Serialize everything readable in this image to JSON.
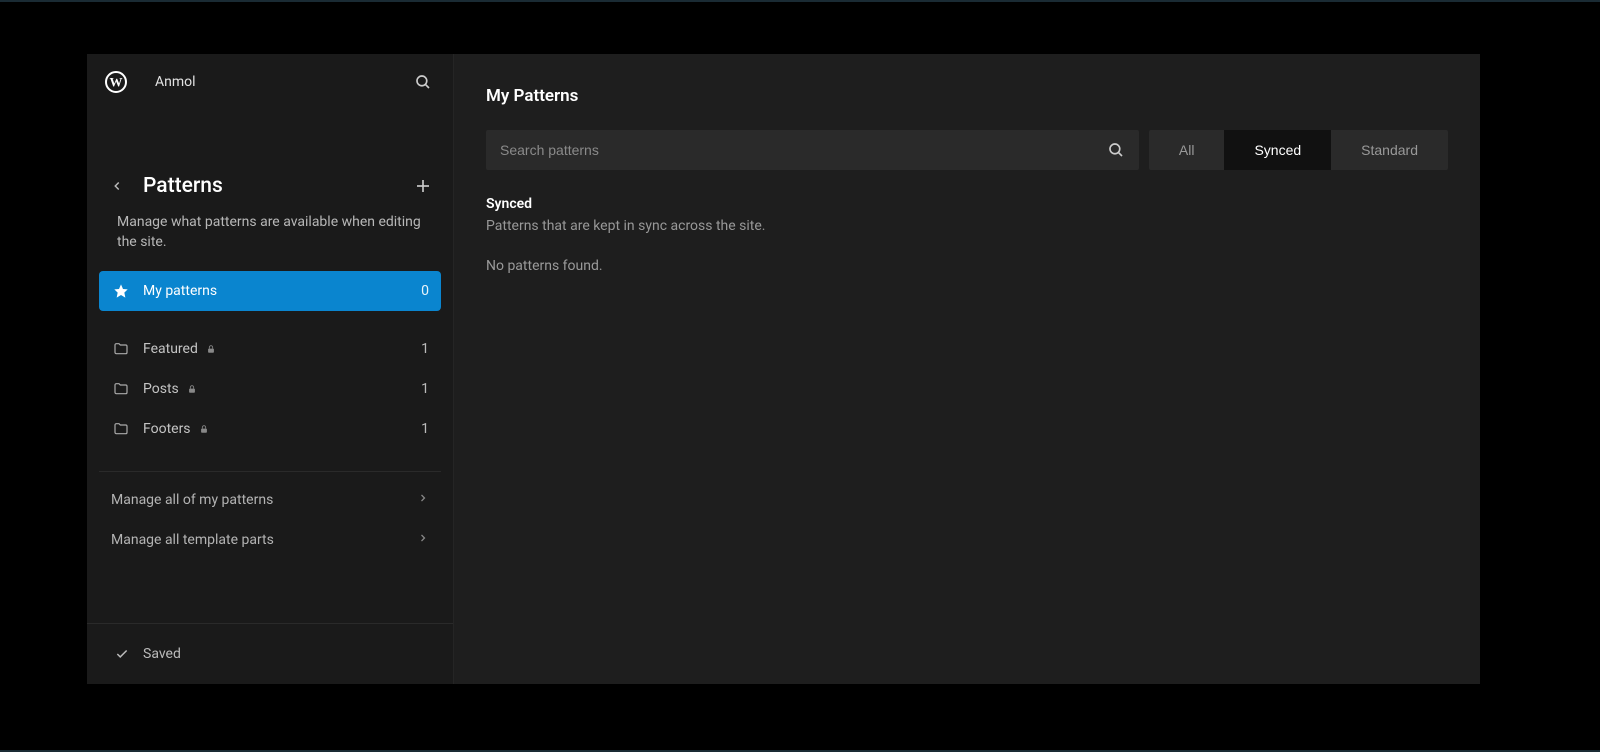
{
  "sidebar": {
    "site_name": "Anmol",
    "section_title": "Patterns",
    "section_description": "Manage what patterns are available when editing the site.",
    "my_patterns": {
      "label": "My patterns",
      "count": "0"
    },
    "categories": [
      {
        "label": "Featured",
        "count": "1",
        "locked": true
      },
      {
        "label": "Posts",
        "count": "1",
        "locked": true
      },
      {
        "label": "Footers",
        "count": "1",
        "locked": true
      }
    ],
    "management": [
      {
        "label": "Manage all of my patterns"
      },
      {
        "label": "Manage all template parts"
      }
    ],
    "saved_label": "Saved"
  },
  "main": {
    "title": "My Patterns",
    "search_placeholder": "Search patterns",
    "filters": {
      "all": "All",
      "synced": "Synced",
      "standard": "Standard"
    },
    "group_title": "Synced",
    "group_description": "Patterns that are kept in sync across the site.",
    "empty_message": "No patterns found."
  }
}
